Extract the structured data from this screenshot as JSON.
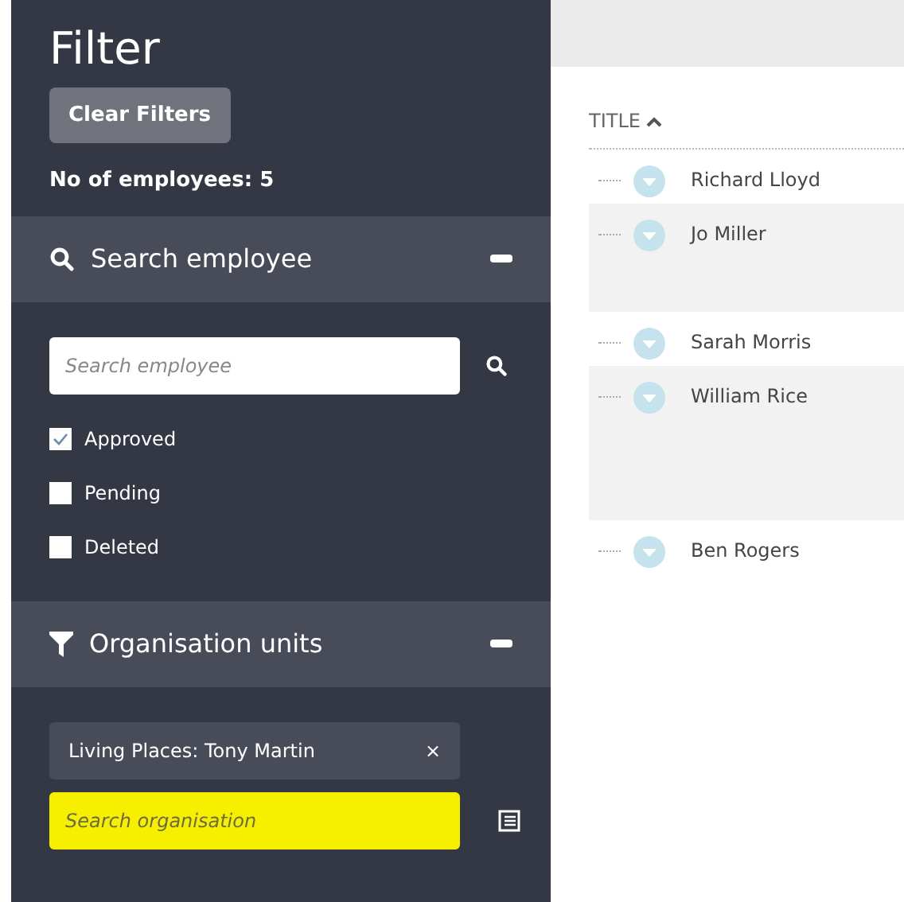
{
  "filter": {
    "title": "Filter",
    "clear_button": "Clear Filters",
    "employee_count": "No of employees: 5",
    "employee_section": {
      "title": "Search employee",
      "expanded": true,
      "search": {
        "placeholder": "Search employee"
      },
      "statuses": [
        {
          "label": "Approved",
          "checked": true
        },
        {
          "label": "Pending",
          "checked": false
        },
        {
          "label": "Deleted",
          "checked": false
        }
      ]
    },
    "org_section": {
      "title": "Organisation units",
      "expanded": true,
      "chips": [
        {
          "label": "Living Places: Tony Martin",
          "remove": "×"
        }
      ],
      "search": {
        "placeholder": "Search organisation",
        "highlighted": true
      }
    }
  },
  "table": {
    "column": {
      "label": "TITLE",
      "sorted_ascending": true
    },
    "rows": [
      {
        "name": "Richard Lloyd",
        "expanded": false
      },
      {
        "name": "Jo Miller",
        "expanded": true
      },
      {
        "name": "Sarah Morris",
        "expanded": false
      },
      {
        "name": "William Rice",
        "expanded": true
      },
      {
        "name": "Ben Rogers",
        "expanded": false
      }
    ]
  }
}
